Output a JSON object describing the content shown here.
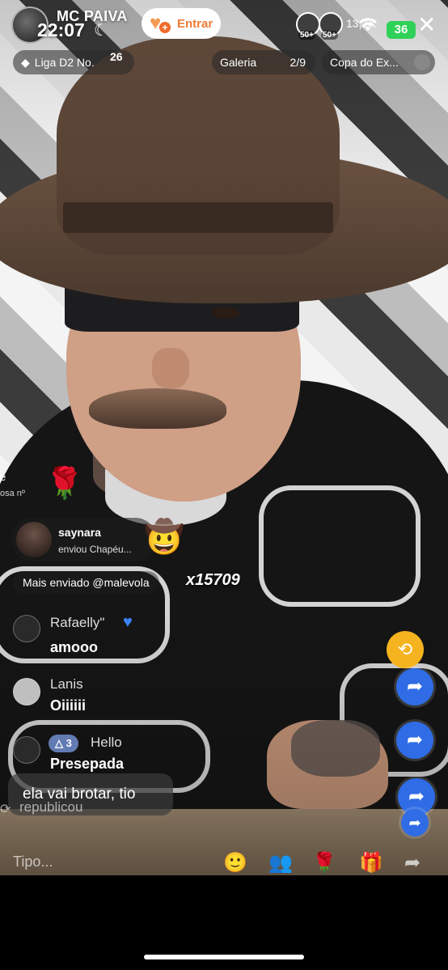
{
  "status_bar": {
    "time": "22:07",
    "battery": "36"
  },
  "host": {
    "name": "MC PAIVA",
    "follow_label": "Entrar"
  },
  "viewers": {
    "badges": [
      "50+",
      "50+"
    ],
    "count": "13,2K"
  },
  "pills": {
    "liga": "Liga D2 No.",
    "liga_number": "26",
    "galeria": "Galeria",
    "galeria_count": "2/9",
    "copa": "Copa do Ex..."
  },
  "gift_feed": {
    "fragment_top": "e",
    "fragment_sub": "osa nº",
    "sender": "saynara",
    "sent_text": "enviou Chapéu...",
    "most_sent": "Mais enviado @malevola",
    "combo": "x15709"
  },
  "chat": [
    {
      "name": "Rafaelly\"",
      "text": "amooo"
    },
    {
      "name": "Lanis",
      "text": "Oiiiiii"
    },
    {
      "name": "Hello",
      "text": "Presepada",
      "level": "3"
    }
  ],
  "comment_bubble": "ela vai brotar, tio",
  "republish_text": "republicou",
  "input": {
    "placeholder": "Tipo..."
  },
  "icons": {
    "close": "close-icon",
    "share": "share-icon",
    "repost": "repost-icon",
    "gift": "gift-icon",
    "rose": "rose-icon",
    "hat": "cowboy-hat-icon"
  },
  "colors": {
    "share_blue": "#2f6ce5",
    "repost_yellow": "#f5b41f",
    "follow_orange": "#ef7b36",
    "battery_green": "#30d158"
  }
}
